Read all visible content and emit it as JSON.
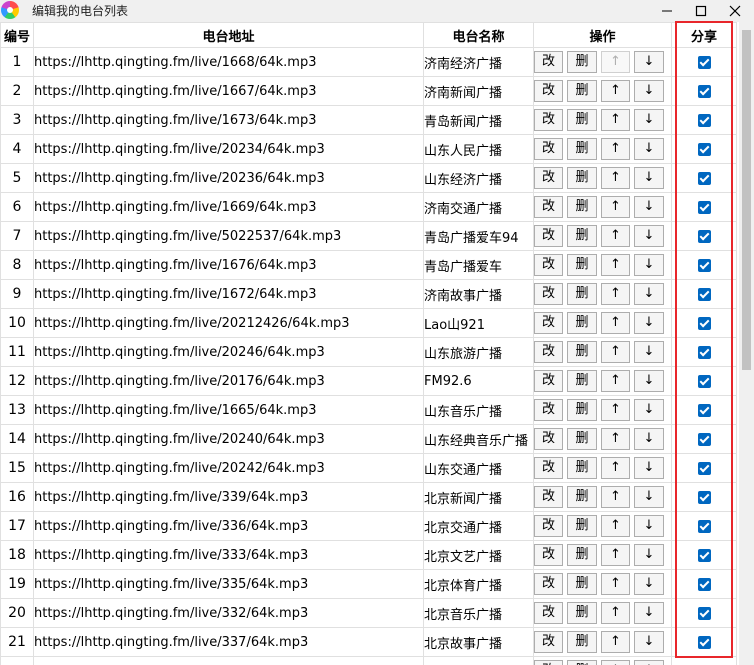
{
  "window": {
    "title": "编辑我的电台列表",
    "controls": {
      "minimize": "—",
      "maximize": "☐",
      "close": "✕"
    }
  },
  "columns": [
    "编号",
    "电台地址",
    "电台名称",
    "操作",
    "分享"
  ],
  "op_labels": {
    "edit": "改",
    "delete": "删",
    "up": "↑",
    "down": "↓"
  },
  "rows": [
    {
      "no": "1",
      "url": "https://lhttp.qingting.fm/live/1668/64k.mp3",
      "name": "济南经济广播",
      "up_enabled": false,
      "shared": true
    },
    {
      "no": "2",
      "url": "https://lhttp.qingting.fm/live/1667/64k.mp3",
      "name": "济南新闻广播",
      "up_enabled": true,
      "shared": true
    },
    {
      "no": "3",
      "url": "https://lhttp.qingting.fm/live/1673/64k.mp3",
      "name": "青岛新闻广播",
      "up_enabled": true,
      "shared": true
    },
    {
      "no": "4",
      "url": "https://lhttp.qingting.fm/live/20234/64k.mp3",
      "name": "山东人民广播",
      "up_enabled": true,
      "shared": true
    },
    {
      "no": "5",
      "url": "https://lhttp.qingting.fm/live/20236/64k.mp3",
      "name": "山东经济广播",
      "up_enabled": true,
      "shared": true
    },
    {
      "no": "6",
      "url": "https://lhttp.qingting.fm/live/1669/64k.mp3",
      "name": "济南交通广播",
      "up_enabled": true,
      "shared": true
    },
    {
      "no": "7",
      "url": "https://lhttp.qingting.fm/live/5022537/64k.mp3",
      "name": "青岛广播爱车94",
      "up_enabled": true,
      "shared": true
    },
    {
      "no": "8",
      "url": "https://lhttp.qingting.fm/live/1676/64k.mp3",
      "name": "青岛广播爱车",
      "up_enabled": true,
      "shared": true
    },
    {
      "no": "9",
      "url": "https://lhttp.qingting.fm/live/1672/64k.mp3",
      "name": "济南故事广播",
      "up_enabled": true,
      "shared": true
    },
    {
      "no": "10",
      "url": "https://lhttp.qingting.fm/live/20212426/64k.mp3",
      "name": "Lao山921",
      "up_enabled": true,
      "shared": true
    },
    {
      "no": "11",
      "url": "https://lhttp.qingting.fm/live/20246/64k.mp3",
      "name": "山东旅游广播",
      "up_enabled": true,
      "shared": true
    },
    {
      "no": "12",
      "url": "https://lhttp.qingting.fm/live/20176/64k.mp3",
      "name": "FM92.6",
      "up_enabled": true,
      "shared": true
    },
    {
      "no": "13",
      "url": "https://lhttp.qingting.fm/live/1665/64k.mp3",
      "name": "山东音乐广播",
      "up_enabled": true,
      "shared": true
    },
    {
      "no": "14",
      "url": "https://lhttp.qingting.fm/live/20240/64k.mp3",
      "name": "山东经典音乐广播",
      "up_enabled": true,
      "shared": true
    },
    {
      "no": "15",
      "url": "https://lhttp.qingting.fm/live/20242/64k.mp3",
      "name": "山东交通广播",
      "up_enabled": true,
      "shared": true
    },
    {
      "no": "16",
      "url": "https://lhttp.qingting.fm/live/339/64k.mp3",
      "name": "北京新闻广播",
      "up_enabled": true,
      "shared": true
    },
    {
      "no": "17",
      "url": "https://lhttp.qingting.fm/live/336/64k.mp3",
      "name": "北京交通广播",
      "up_enabled": true,
      "shared": true
    },
    {
      "no": "18",
      "url": "https://lhttp.qingting.fm/live/333/64k.mp3",
      "name": "北京文艺广播",
      "up_enabled": true,
      "shared": true
    },
    {
      "no": "19",
      "url": "https://lhttp.qingting.fm/live/335/64k.mp3",
      "name": "北京体育广播",
      "up_enabled": true,
      "shared": true
    },
    {
      "no": "20",
      "url": "https://lhttp.qingting.fm/live/332/64k.mp3",
      "name": "北京音乐广播",
      "up_enabled": true,
      "shared": true
    },
    {
      "no": "21",
      "url": "https://lhttp.qingting.fm/live/337/64k.mp3",
      "name": "北京故事广播",
      "up_enabled": true,
      "shared": true
    },
    {
      "no": "",
      "url": "",
      "name": "",
      "up_enabled": true,
      "shared": true
    }
  ],
  "colors": {
    "highlight": "#e8262b",
    "checkbox": "#0067c0",
    "grid_line": "#e0e0e0"
  }
}
